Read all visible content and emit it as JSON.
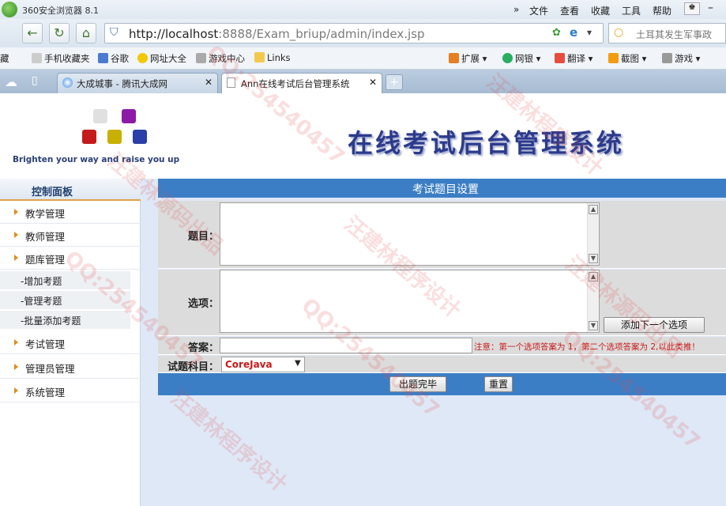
{
  "browser": {
    "title": "360安全浏览器 8.1",
    "menu": [
      "文件",
      "查看",
      "收藏",
      "工具",
      "帮助"
    ],
    "address": {
      "host": "http://localhost",
      "path": ":8888/Exam_briup/admin/index.jsp"
    },
    "search_placeholder": "土耳其发生军事政",
    "favorites": [
      "藏",
      "手机收藏夹",
      "谷歌",
      "网址大全",
      "游戏中心",
      "Links"
    ],
    "tools": [
      "扩展",
      "网银",
      "翻译",
      "截图",
      "游戏"
    ],
    "tabs": [
      "大成城事 - 腾讯大成网",
      "Ann在线考试后台管理系统"
    ],
    "new_tab": "+"
  },
  "page": {
    "banner_title": "在线考试后台管理系统",
    "slogan": "Brighten your way and raise you up",
    "sidebar": {
      "title": "控制面板",
      "items": [
        "教学管理",
        "教师管理",
        "题库管理"
      ],
      "subitems": [
        "-增加考题",
        "-管理考题",
        "-批量添加考题"
      ],
      "items2": [
        "考试管理",
        "管理员管理",
        "系统管理"
      ]
    },
    "form": {
      "header": "考试题目设置",
      "question_label": "题目：",
      "options_label": "选项：",
      "add_option_button": "添加下一个选项",
      "answer_label": "答案：",
      "answer_note": "注意：第一个选项答案为 1，第二个选项答案为 2,以此类推！",
      "subject_label": "试题科目：",
      "subject_value": "CoreJava",
      "submit_button": "出题完毕",
      "reset_button": "重置"
    }
  },
  "watermark": {
    "text1": "QQ:254540457",
    "text2": "汪建林程序设计",
    "text3": "汪建林源码出品"
  }
}
